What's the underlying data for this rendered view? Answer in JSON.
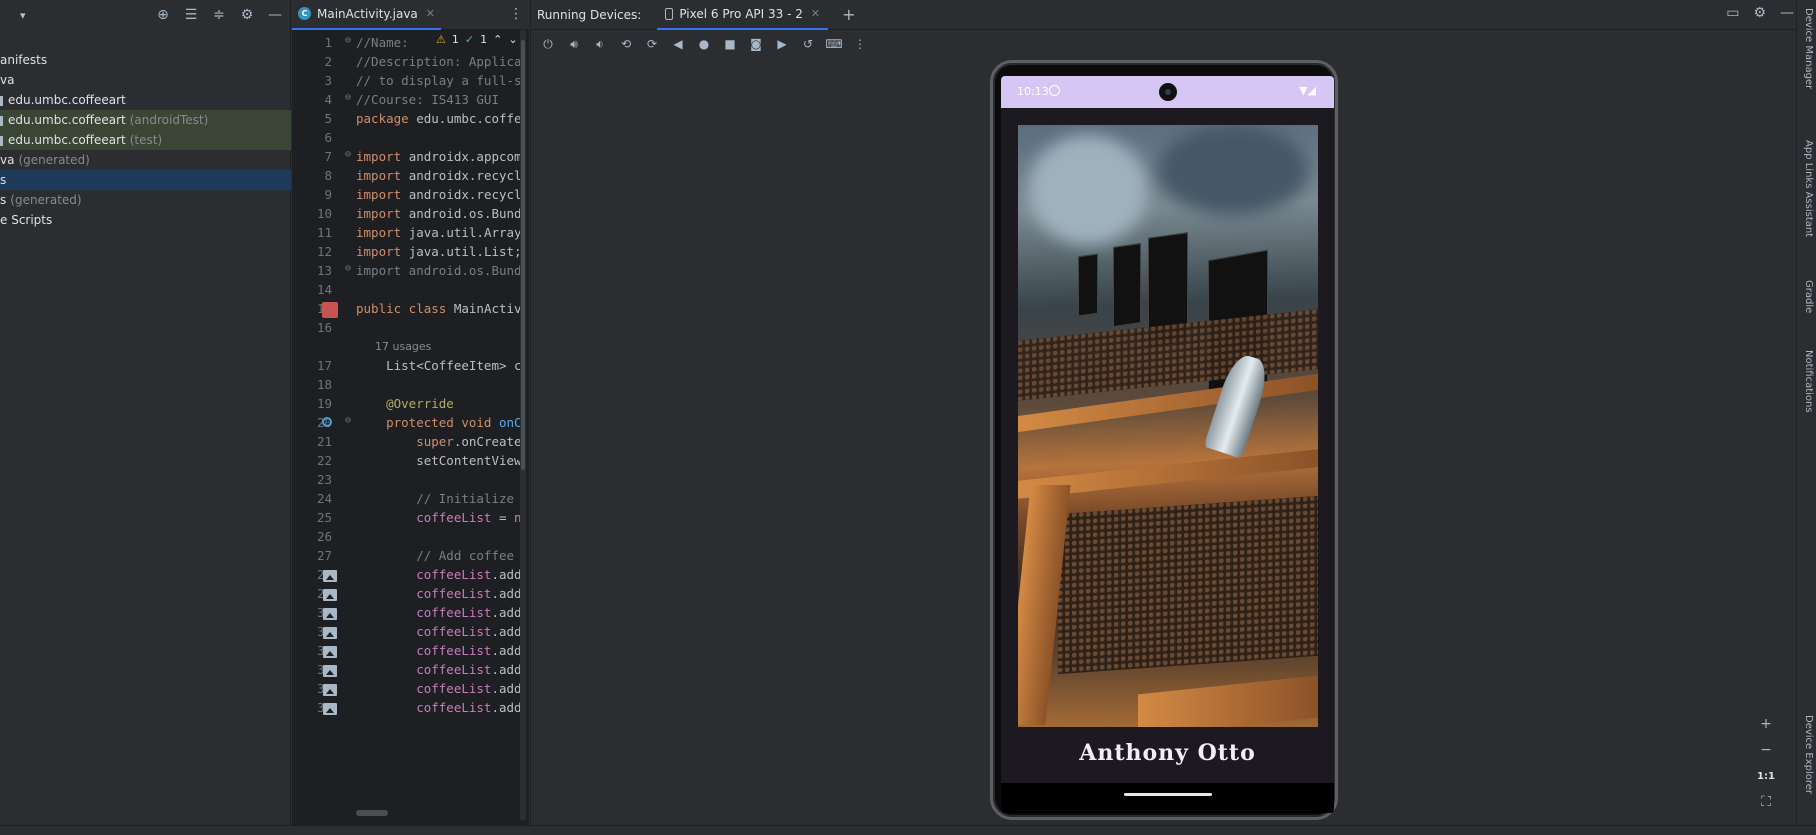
{
  "project": {
    "tree": [
      {
        "label": "anifests",
        "hint": "",
        "style": "normal",
        "bar": false
      },
      {
        "label": "va",
        "hint": "",
        "style": "normal",
        "bar": false
      },
      {
        "label": "edu.umbc.coffeeart",
        "hint": "",
        "style": "normal",
        "bar": true
      },
      {
        "label": "edu.umbc.coffeeart",
        "hint": "(androidTest)",
        "style": "green",
        "bar": true
      },
      {
        "label": "edu.umbc.coffeeart",
        "hint": "(test)",
        "style": "green",
        "bar": true
      },
      {
        "label": "va",
        "hint": "(generated)",
        "style": "normal",
        "bar": false
      },
      {
        "label": "s",
        "hint": "",
        "style": "sel",
        "bar": false
      },
      {
        "label": "s",
        "hint": "(generated)",
        "style": "normal",
        "bar": false
      },
      {
        "label": "e Scripts",
        "hint": "",
        "style": "normal",
        "bar": false
      }
    ]
  },
  "editor": {
    "tab_label": "MainActivity.java",
    "tab_icon": "C",
    "warnings": "1",
    "checks": "1",
    "lines": [
      {
        "n": "1",
        "parts": [
          [
            "cm",
            "//Name: "
          ]
        ]
      },
      {
        "n": "2",
        "parts": [
          [
            "cm",
            "//Description: Applica"
          ]
        ]
      },
      {
        "n": "3",
        "parts": [
          [
            "cm",
            "// to display a full-s"
          ]
        ]
      },
      {
        "n": "4",
        "parts": [
          [
            "cm",
            "//Course: IS413 GUI"
          ]
        ]
      },
      {
        "n": "5",
        "parts": [
          [
            "kw",
            "package "
          ],
          [
            "",
            "edu.umbc.coffe"
          ]
        ]
      },
      {
        "n": "6",
        "parts": []
      },
      {
        "n": "7",
        "parts": [
          [
            "kw",
            "import "
          ],
          [
            "",
            "androidx.appcom"
          ]
        ]
      },
      {
        "n": "8",
        "parts": [
          [
            "kw",
            "import "
          ],
          [
            "",
            "androidx.recycl"
          ]
        ]
      },
      {
        "n": "9",
        "parts": [
          [
            "kw",
            "import "
          ],
          [
            "",
            "androidx.recycl"
          ]
        ]
      },
      {
        "n": "10",
        "parts": [
          [
            "kw",
            "import "
          ],
          [
            "",
            "android.os.Bund"
          ]
        ]
      },
      {
        "n": "11",
        "parts": [
          [
            "kw",
            "import "
          ],
          [
            "",
            "java.util.Array"
          ]
        ]
      },
      {
        "n": "12",
        "parts": [
          [
            "kw",
            "import "
          ],
          [
            "",
            "java.util.List;"
          ]
        ]
      },
      {
        "n": "13",
        "parts": [
          [
            "cm",
            "import android.os.Bund"
          ]
        ]
      },
      {
        "n": "14",
        "parts": []
      },
      {
        "n": "15",
        "parts": [
          [
            "kw",
            "public class "
          ],
          [
            "",
            "MainActiv"
          ]
        ]
      },
      {
        "n": "16",
        "parts": []
      },
      {
        "n": "17",
        "parts": [
          [
            "",
            "    List<CoffeeItem> c"
          ]
        ]
      },
      {
        "n": "18",
        "parts": []
      },
      {
        "n": "19",
        "parts": [
          [
            "an",
            "    @Override"
          ]
        ]
      },
      {
        "n": "20",
        "parts": [
          [
            "kw",
            "    protected void "
          ],
          [
            "fn",
            "onC"
          ]
        ]
      },
      {
        "n": "21",
        "parts": [
          [
            "kw",
            "        super"
          ],
          [
            "",
            ".onCreate"
          ]
        ]
      },
      {
        "n": "22",
        "parts": [
          [
            "",
            "        setContentView"
          ]
        ]
      },
      {
        "n": "23",
        "parts": []
      },
      {
        "n": "24",
        "parts": [
          [
            "cm",
            "        // Initialize "
          ]
        ]
      },
      {
        "n": "25",
        "parts": [
          [
            "fld",
            "        coffeeList"
          ],
          [
            "",
            " = "
          ],
          [
            "kw",
            "n"
          ]
        ]
      },
      {
        "n": "26",
        "parts": []
      },
      {
        "n": "27",
        "parts": [
          [
            "cm",
            "        // Add coffee "
          ]
        ]
      },
      {
        "n": "28",
        "parts": [
          [
            "fld",
            "        coffeeList"
          ],
          [
            "",
            ".add"
          ]
        ]
      },
      {
        "n": "29",
        "parts": [
          [
            "fld",
            "        coffeeList"
          ],
          [
            "",
            ".add"
          ]
        ]
      },
      {
        "n": "30",
        "parts": [
          [
            "fld",
            "        coffeeList"
          ],
          [
            "",
            ".add"
          ]
        ]
      },
      {
        "n": "31",
        "parts": [
          [
            "fld",
            "        coffeeList"
          ],
          [
            "",
            ".add"
          ]
        ]
      },
      {
        "n": "32",
        "parts": [
          [
            "fld",
            "        coffeeList"
          ],
          [
            "",
            ".add"
          ]
        ]
      },
      {
        "n": "33",
        "parts": [
          [
            "fld",
            "        coffeeList"
          ],
          [
            "",
            ".add"
          ]
        ]
      },
      {
        "n": "34",
        "parts": [
          [
            "fld",
            "        coffeeList"
          ],
          [
            "",
            ".add"
          ]
        ]
      },
      {
        "n": "35",
        "parts": [
          [
            "fld",
            "        coffeeList"
          ],
          [
            "",
            ".add"
          ]
        ]
      }
    ],
    "usages_hint": "17 usages"
  },
  "running_devices": {
    "label": "Running Devices:",
    "device_tab": "Pixel 6 Pro API 33 - 2",
    "toolbar_icons": [
      "power-icon",
      "volume-up-icon",
      "volume-down-icon",
      "rotate-left-icon",
      "rotate-right-icon",
      "back-icon",
      "home-icon",
      "overview-icon",
      "screenshot-icon",
      "screen-record-icon",
      "snapshot-icon",
      "extended-controls-icon",
      "more-icon"
    ]
  },
  "phone": {
    "time": "10:13",
    "app_name": "Anthony Otto"
  },
  "zoom": {
    "plus": "+",
    "minus": "−",
    "actual": "1:1"
  },
  "right_strip": [
    "Device Manager",
    "App Links Assistant",
    "Gradle",
    "Notifications",
    "Device Explorer"
  ],
  "colors": {
    "accent": "#3574f0",
    "status_bar": "#d6c6f5",
    "app_bg": "#1c1a20"
  }
}
